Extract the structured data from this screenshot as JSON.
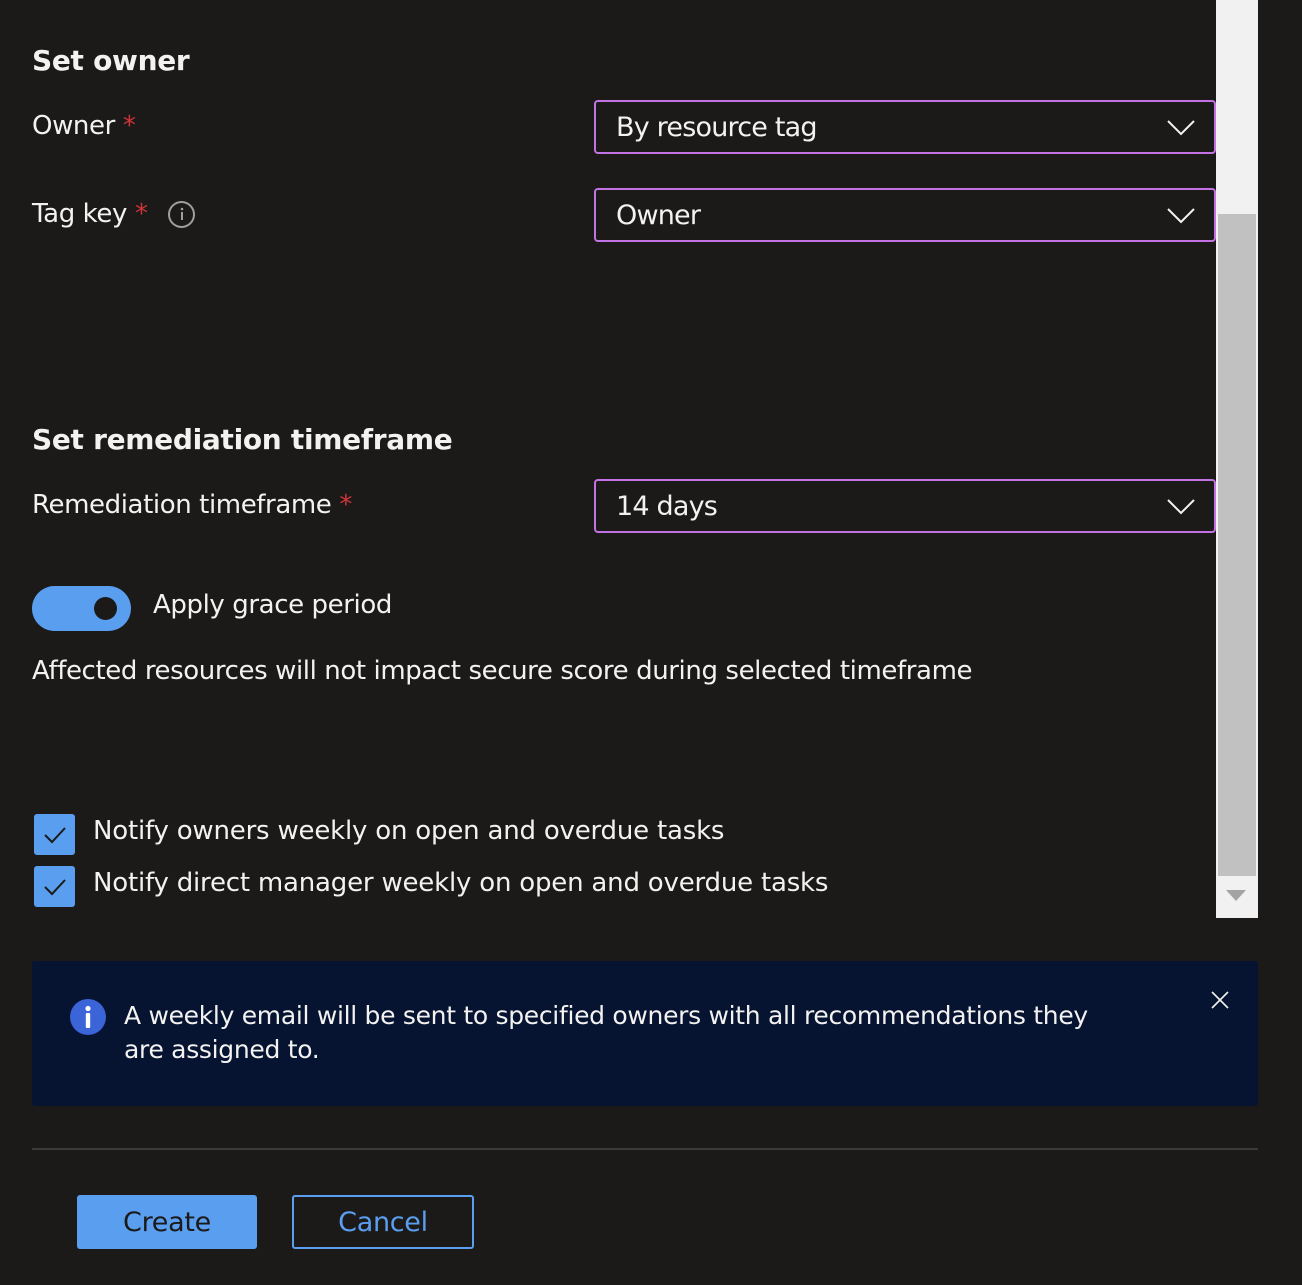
{
  "set_owner": {
    "title": "Set owner",
    "owner": {
      "label": "Owner",
      "required_mark": "*",
      "value": "By resource tag"
    },
    "tag_key": {
      "label": "Tag key",
      "required_mark": "*",
      "info_icon": "info-icon",
      "value": "Owner"
    }
  },
  "remediation": {
    "title": "Set remediation timeframe",
    "timeframe": {
      "label": "Remediation timeframe",
      "required_mark": "*",
      "value": "14 days"
    },
    "grace_period": {
      "label": "Apply grace period",
      "enabled": true,
      "description": "Affected resources will not impact secure score during selected timeframe"
    }
  },
  "notifications": [
    {
      "label": "Notify owners weekly on open and overdue tasks",
      "checked": true
    },
    {
      "label": "Notify direct manager weekly on open and overdue tasks",
      "checked": true
    }
  ],
  "info_banner": {
    "icon": "info-icon",
    "text": "A weekly email will be sent to specified owners with all recommendations they are assigned to.",
    "close_icon": "close-icon"
  },
  "footer": {
    "create_label": "Create",
    "cancel_label": "Cancel"
  },
  "colors": {
    "background": "#1b1a19",
    "accent": "#5a9ef0",
    "focus_border": "#c372e3",
    "required": "#d13438",
    "banner_bg": "#061431",
    "banner_icon": "#3a64d8"
  }
}
